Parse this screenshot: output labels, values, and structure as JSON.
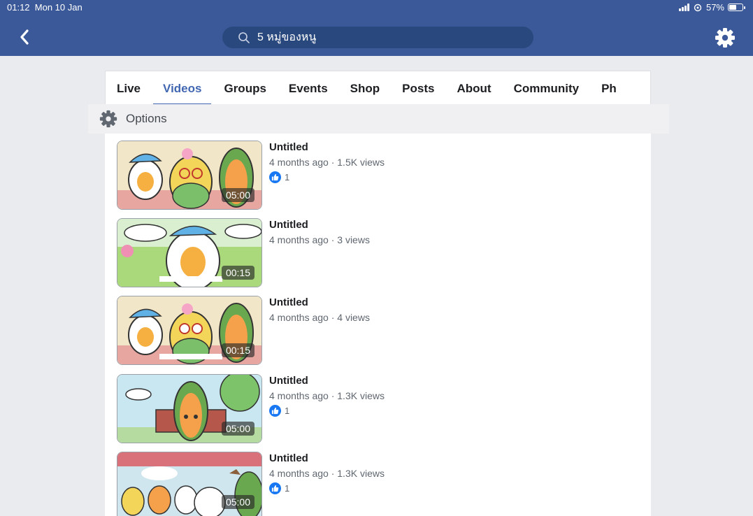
{
  "status_bar": {
    "time": "01:12",
    "date": "Mon 10 Jan",
    "battery": "57%",
    "battery_level": 0.57
  },
  "header": {
    "search_text": "5 หมู่ของหนู"
  },
  "tabs": [
    {
      "label": "Live"
    },
    {
      "label": "Videos",
      "active": true
    },
    {
      "label": "Groups"
    },
    {
      "label": "Events"
    },
    {
      "label": "Shop"
    },
    {
      "label": "Posts"
    },
    {
      "label": "About"
    },
    {
      "label": "Community"
    },
    {
      "label": "Ph"
    }
  ],
  "options": {
    "label": "Options"
  },
  "videos": [
    {
      "title": "Untitled",
      "subtitle": "4 months ago · 1.5K views",
      "likes": "1",
      "duration": "05:00"
    },
    {
      "title": "Untitled",
      "subtitle": "4 months ago · 3 views",
      "likes": "",
      "duration": "00:15"
    },
    {
      "title": "Untitled",
      "subtitle": "4 months ago · 4 views",
      "likes": "",
      "duration": "00:15"
    },
    {
      "title": "Untitled",
      "subtitle": "4 months ago · 1.3K views",
      "likes": "1",
      "duration": "05:00"
    },
    {
      "title": "Untitled",
      "subtitle": "4 months ago · 1.3K views",
      "likes": "1",
      "duration": "05:00"
    }
  ],
  "colors": {
    "header": "#3b5998",
    "search_bg": "#29487d",
    "accent": "#4267b2",
    "like": "#1877f2"
  },
  "icons": [
    "back-chevron-icon",
    "search-icon",
    "gear-icon",
    "options-gear-icon",
    "like-thumb-icon"
  ]
}
